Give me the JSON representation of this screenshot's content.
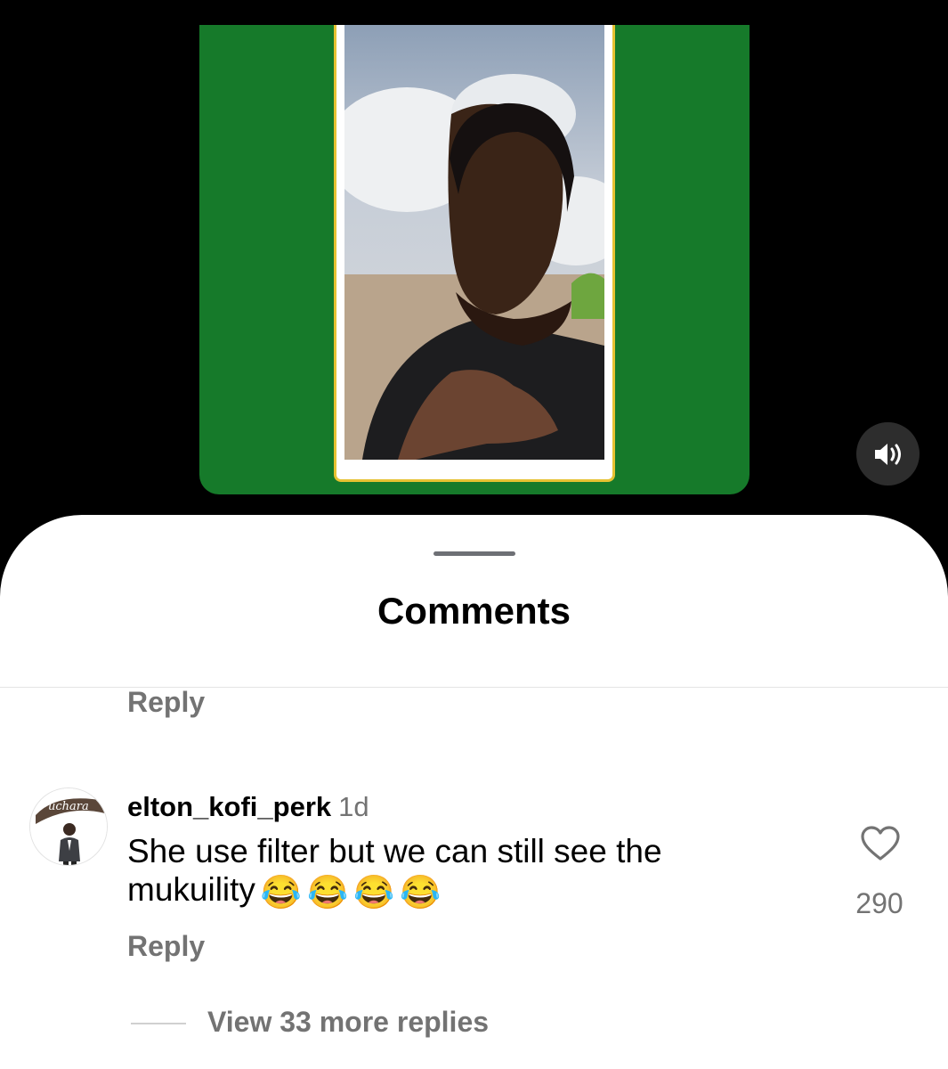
{
  "video": {
    "sound_icon": "speaker-icon"
  },
  "comments_sheet": {
    "title": "Comments",
    "top_reply_label": "Reply",
    "comment": {
      "username": "elton_kofi_perk",
      "time": "1d",
      "text": "She use filter but we can still see the mukuility",
      "emojis": [
        "😂",
        "😂",
        "😂",
        "😂"
      ],
      "reply_label": "Reply",
      "like_icon": "heart-icon",
      "like_count": "290",
      "avatar_text": "uchara"
    },
    "view_replies_label": "View 33 more replies"
  }
}
